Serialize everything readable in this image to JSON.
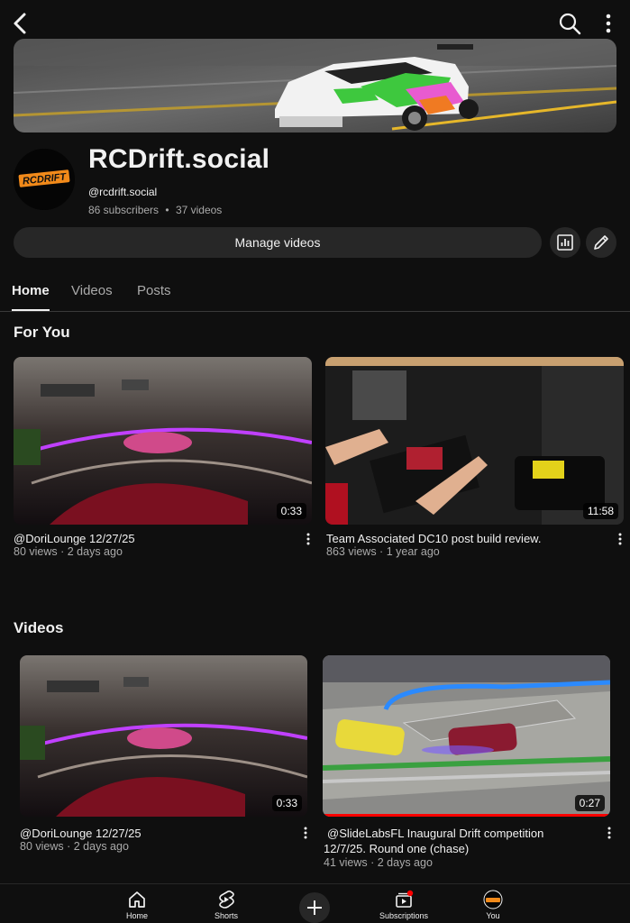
{
  "header": {
    "back_icon": "arrow-back-icon",
    "search_icon": "search-icon",
    "more_icon": "more-vert-icon"
  },
  "channel": {
    "name": "RCDrift.social",
    "handle": "@rcdrift.social",
    "subscribers": "86 subscribers",
    "separator": "•",
    "video_count": "37 videos",
    "avatar_logo_text": "RCDRIFT"
  },
  "actions": {
    "manage_videos": "Manage videos",
    "stats_icon": "analytics-icon",
    "edit_icon": "pencil-icon"
  },
  "tabs": [
    {
      "label": "Home",
      "active": true
    },
    {
      "label": "Videos",
      "active": false
    },
    {
      "label": "Posts",
      "active": false
    }
  ],
  "for_you": {
    "title": "For You",
    "videos": [
      {
        "title": "@DoriLounge 12/27/25",
        "meta": "80 views · 2 days ago",
        "duration": "0:33"
      },
      {
        "title": "Team Associated DC10 post build review.",
        "meta": "863 views · 1 year ago",
        "duration": "11:58"
      }
    ]
  },
  "videos_section": {
    "title": "Videos",
    "videos": [
      {
        "title": "@DoriLounge 12/27/25",
        "meta": "80 views · 2 days ago",
        "duration": "0:33"
      },
      {
        "title_line1": "@SlideLabsFL Inaugural Drift competition",
        "title_line2": "12/7/25. Round one (chase)",
        "meta": "41 views · 2 days ago",
        "duration": "0:27",
        "watched_fraction": 1.0
      }
    ]
  },
  "bottom_nav": [
    {
      "label": "Home",
      "icon": "home-icon"
    },
    {
      "label": "Shorts",
      "icon": "shorts-icon"
    },
    {
      "label": "",
      "icon": "create-plus-icon"
    },
    {
      "label": "Subscriptions",
      "icon": "subscriptions-icon"
    },
    {
      "label": "You",
      "icon": "avatar-icon"
    }
  ],
  "colors": {
    "background": "#0f0f0f",
    "surface": "#272727",
    "secondary_text": "#aaaaaa",
    "accent_red": "#ff0000"
  }
}
